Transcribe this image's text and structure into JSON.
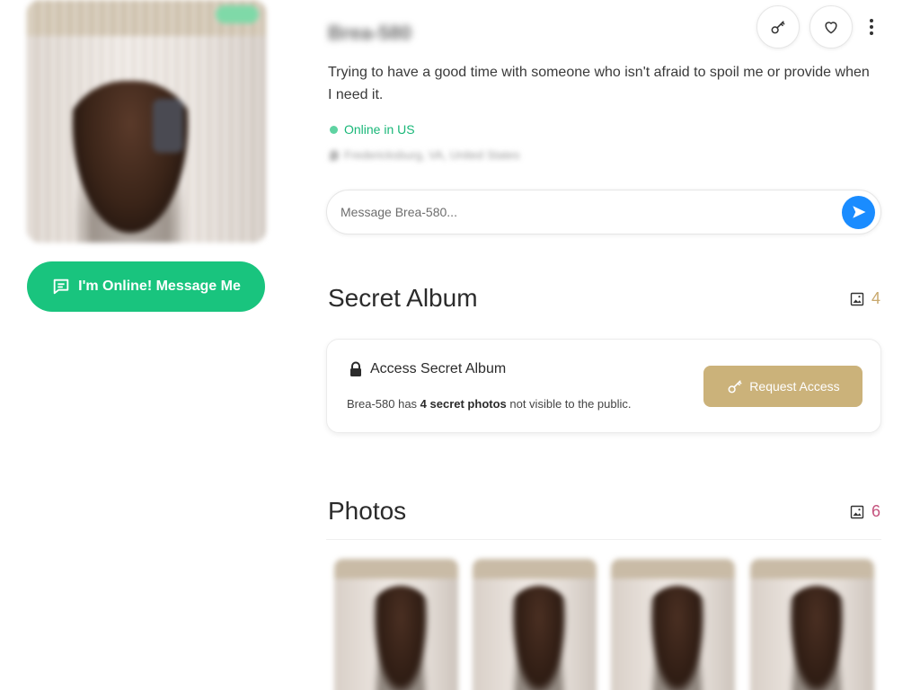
{
  "profile": {
    "username": "Brea-580",
    "bio": "Trying to have a good time with someone who isn't afraid to spoil me or provide when I need it.",
    "online_status": "Online in US",
    "location": "Fredericksburg, VA, United States",
    "online_button_label": "I'm Online! Message Me"
  },
  "message": {
    "placeholder": "Message Brea-580..."
  },
  "secret_album": {
    "title": "Secret Album",
    "count": "4",
    "card_title": "Access Secret Album",
    "desc_prefix": "Brea-580 has ",
    "desc_bold": "4 secret photos",
    "desc_suffix": " not visible to the public.",
    "request_button_label": "Request Access"
  },
  "photos": {
    "title": "Photos",
    "count": "6"
  },
  "colors": {
    "online_green": "#19c47e",
    "send_blue": "#1a8cff",
    "gold": "#cbb27a",
    "pink_count": "#c4527d"
  },
  "icons": {
    "online_button": "chat-bubble-icon",
    "key": "key-icon",
    "heart": "heart-icon",
    "more": "more-vertical-icon",
    "send": "send-icon",
    "image_count": "image-icon",
    "lock": "lock-icon"
  }
}
